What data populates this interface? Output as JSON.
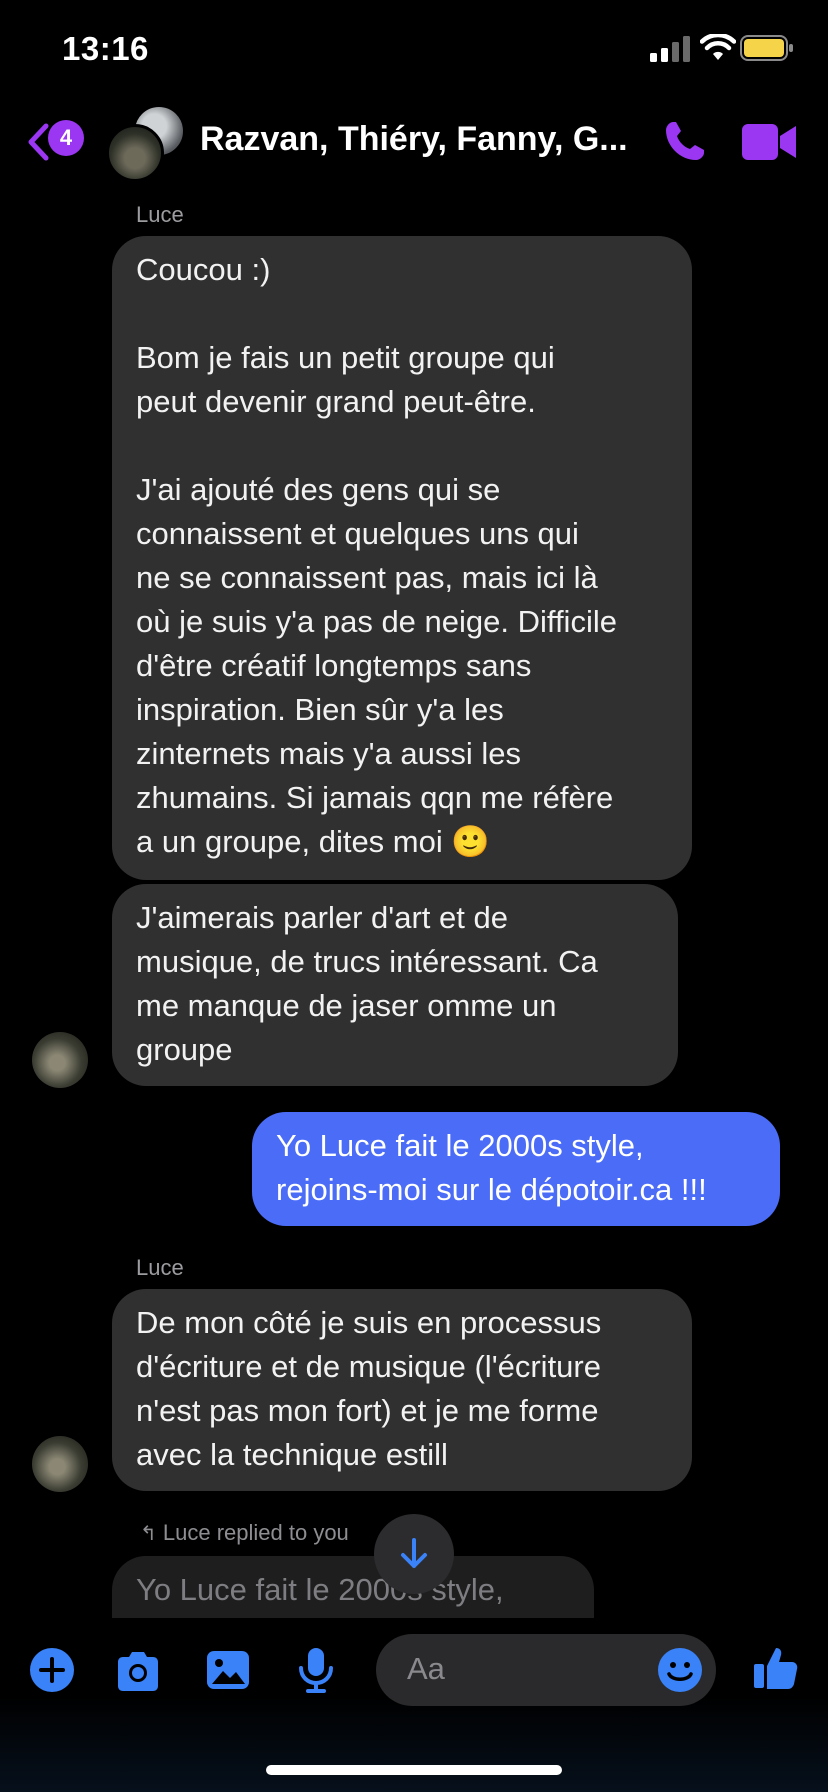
{
  "status_bar": {
    "time": "13:16"
  },
  "header": {
    "back_badge_count": "4",
    "title": "Razvan, Thiéry, Fanny, G...",
    "accent_color": "#9b36f3"
  },
  "messages": [
    {
      "sender": "Luce",
      "text": "Coucou :)\n\nBom je fais un petit groupe qui\npeut devenir grand peut-être.\n\nJ'ai ajouté des gens qui se\nconnaissent et quelques uns qui\nne se connaissent pas, mais ici là\noù je suis y'a pas de neige. Difficile\nd'être créatif longtemps sans\ninspiration. Bien sûr y'a les\nzinternets mais y'a aussi les\nzhumains. Si jamais qqn me réfère\na un groupe, dites moi 🙂"
    },
    {
      "text": "J'aimerais parler d'art et de\nmusique, de trucs intéressant. Ca\nme manque de jaser  omme un\ngroupe"
    },
    {
      "outgoing": true,
      "text": "Yo Luce fait le 2000s style,\nrejoins-moi sur le dépotoir.ca !!!",
      "color": "#4b6cf6"
    },
    {
      "sender": "Luce",
      "text": "De mon côté je suis en processus\nd'écriture et de musique (l'écriture\nn'est pas mon fort) et je me forme\navec la technique estill"
    }
  ],
  "reply": {
    "label": "Luce replied to you",
    "quoted_text": "Yo Luce fait le 2000s style,"
  },
  "composer": {
    "placeholder": "Aa",
    "icons": [
      "plus-icon",
      "camera-icon",
      "image-icon",
      "microphone-icon",
      "emoji-icon",
      "thumbs-up-icon"
    ],
    "icon_color": "#3a82f7"
  }
}
